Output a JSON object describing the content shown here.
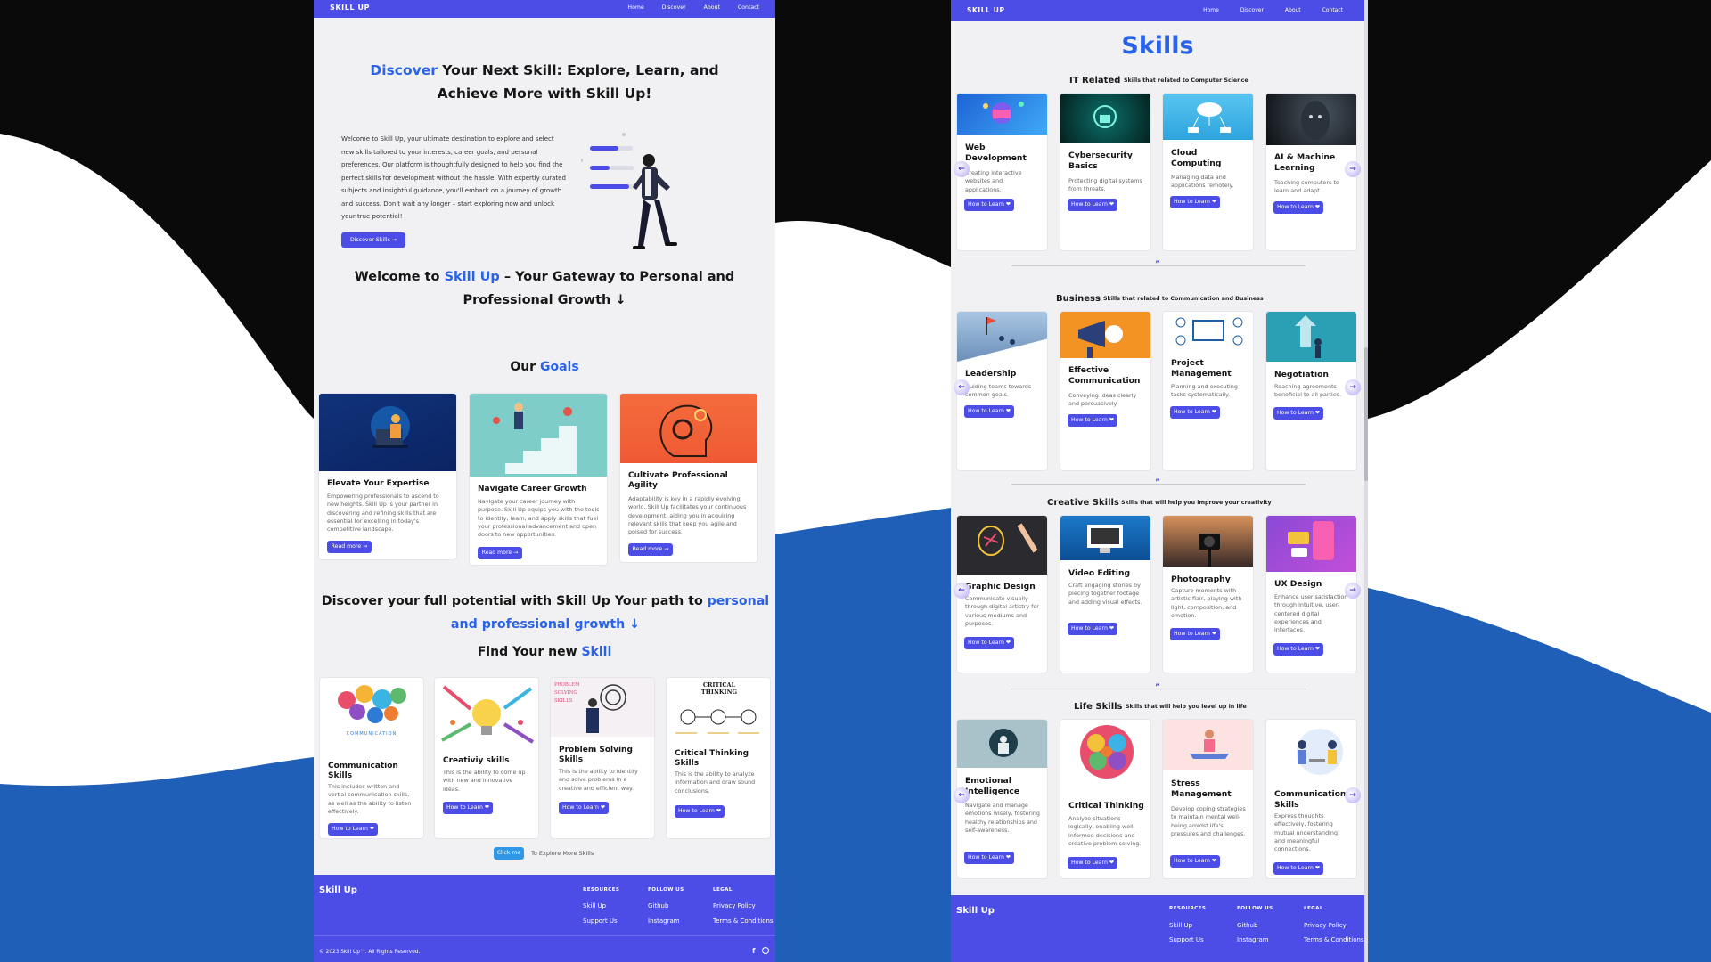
{
  "nav": {
    "brand": "SKILL UP",
    "links": [
      "Home",
      "Discover",
      "About",
      "Contact"
    ]
  },
  "hero": {
    "word": "Discover",
    "rest": " Your Next Skill: Explore, Learn, and Achieve More with Skill Up!",
    "paragraph": "Welcome to Skill Up, your ultimate destination to explore and select new skills tailored to your interests, career goals, and personal preferences. Our platform is thoughtfully designed to help you find the perfect skills for development without the hassle. With expertly curated subjects and insightful guidance, you'll embark on a journey of growth and success. Don't wait any longer – start exploring now and unlock your true potential!",
    "button": "Discover Skills →"
  },
  "welcome": {
    "pre": "Welcome to ",
    "brand": "Skill Up",
    "post": " – Your Gateway to Personal and Professional Growth ↓"
  },
  "goals": {
    "pre": "Our ",
    "word": "Goals",
    "items": [
      {
        "title": "Elevate Your Expertise",
        "desc": "Empowering professionals to ascend to new heights. Skill Up is your partner in discovering and refining skills that are essential for excelling in today's competitive landscape.",
        "button": "Read more →"
      },
      {
        "title": "Navigate Career Growth",
        "desc": "Navigate your career journey with purpose. Skill Up equips you with the tools to identify, learn, and apply skills that fuel your professional advancement and open doors to new opportunities.",
        "button": "Read more →"
      },
      {
        "title": "Cultivate Professional Agility",
        "desc": "Adaptability is key in a rapidly evolving world. Skill Up facilitates your continuous development, aiding you in acquiring relevant skills that keep you agile and poised for success.",
        "button": "Read more →"
      }
    ]
  },
  "potential": {
    "pre": "Discover your full potential with Skill Up Your path to ",
    "word": "personal and professional growth ↓"
  },
  "find": {
    "pre": "Find Your new ",
    "word": "Skill",
    "items": [
      {
        "title": "Communication Skills",
        "desc": "This includes written and verbal communication skills, as well as the ability to listen effectively.",
        "button": "How to Learn ❤",
        "img": "COMMUNICATION"
      },
      {
        "title": "Creativiy skills",
        "desc": "This is the ability to come up with new and innovative ideas.",
        "button": "How to Learn ❤",
        "img": ""
      },
      {
        "title": "Problem Solving Skills",
        "desc": "This is the ability to identify and solve problems in a creative and efficient way.",
        "button": "How to Learn ❤",
        "img": "PROBLEM SOLVING SKILLS"
      },
      {
        "title": "Critical Thinking Skills",
        "desc": "This is the ability to analyze information and draw sound conclusions.",
        "button": "How to Learn ❤",
        "img": "CRITICAL THINKING"
      }
    ]
  },
  "explore": {
    "button": "Click me",
    "text": "To Explore More Skills"
  },
  "footer": {
    "brand": "Skill Up",
    "cols": [
      {
        "head": "RESOURCES",
        "links": [
          "Skill Up",
          "Support Us"
        ]
      },
      {
        "head": "FOLLOW US",
        "links": [
          "Github",
          "Instagram"
        ]
      },
      {
        "head": "LEGAL",
        "links": [
          "Privacy Policy",
          "Terms & Conditions"
        ]
      }
    ],
    "copyright": "© 2023 Skill Up™. All Rights Reserved."
  },
  "skills_page": {
    "title": "Skills",
    "sections": [
      {
        "name": "IT Related",
        "sub": "Skills that related to Computer Science",
        "cards": [
          {
            "title": "Web Development",
            "desc": "Creating interactive websites and applications.",
            "button": "How to Learn ❤"
          },
          {
            "title": "Cybersecurity Basics",
            "desc": "Protecting digital systems from threats.",
            "button": "How to Learn ❤"
          },
          {
            "title": "Cloud Computing",
            "desc": "Managing data and applications remotely.",
            "button": "How to Learn ❤"
          },
          {
            "title": "AI & Machine Learning",
            "desc": "Teaching computers to learn and adapt.",
            "button": "How to Learn ❤"
          }
        ]
      },
      {
        "name": "Business",
        "sub": "Skills that related to Communication and Business",
        "cards": [
          {
            "title": "Leadership",
            "desc": "Guiding teams towards common goals.",
            "button": "How to Learn ❤"
          },
          {
            "title": "Effective Communication",
            "desc": "Conveying ideas clearly and persuasively.",
            "button": "How to Learn ❤"
          },
          {
            "title": "Project Management",
            "desc": "Planning and executing tasks systematically.",
            "button": "How to Learn ❤"
          },
          {
            "title": "Negotiation",
            "desc": "Reaching agreements beneficial to all parties.",
            "button": "How to Learn ❤"
          }
        ]
      },
      {
        "name": "Creative Skills",
        "sub": "Skills that will help you improve your creativity",
        "cards": [
          {
            "title": "Graphic Design",
            "desc": "Communicate visually through digital artistry for various mediums and purposes.",
            "button": "How to Learn ❤"
          },
          {
            "title": "Video Editing",
            "desc": "Craft engaging stories by piecing together footage and adding visual effects.",
            "button": "How to Learn ❤"
          },
          {
            "title": "Photography",
            "desc": "Capture moments with artistic flair, playing with light, composition, and emotion.",
            "button": "How to Learn ❤"
          },
          {
            "title": "UX Design",
            "desc": "Enhance user satisfaction through intuitive, user-centered digital experiences and interfaces.",
            "button": "How to Learn ❤"
          }
        ]
      },
      {
        "name": "Life Skills",
        "sub": "Skills that will help you level up in life",
        "cards": [
          {
            "title": "Emotional Intelligence",
            "desc": "Navigate and manage emotions wisely, fostering healthy relationships and self-awareness.",
            "button": "How to Learn ❤"
          },
          {
            "title": "Critical Thinking",
            "desc": "Analyze situations logically, enabling well-informed decisions and creative problem-solving.",
            "button": "How to Learn ❤"
          },
          {
            "title": "Stress Management",
            "desc": "Develop coping strategies to maintain mental well-being amidst life's pressures and challenges.",
            "button": "How to Learn ❤"
          },
          {
            "title": "Communication Skills",
            "desc": "Express thoughts effectively, fostering mutual understanding and meaningful connections.",
            "button": "How to Learn ❤"
          }
        ]
      }
    ],
    "divider_glyph": "”"
  },
  "colors": {
    "accent": "#4c4de6",
    "link_blue": "#2a63e8",
    "wave_blue": "#1f5fb8",
    "page_bg": "#f1f1f3"
  }
}
